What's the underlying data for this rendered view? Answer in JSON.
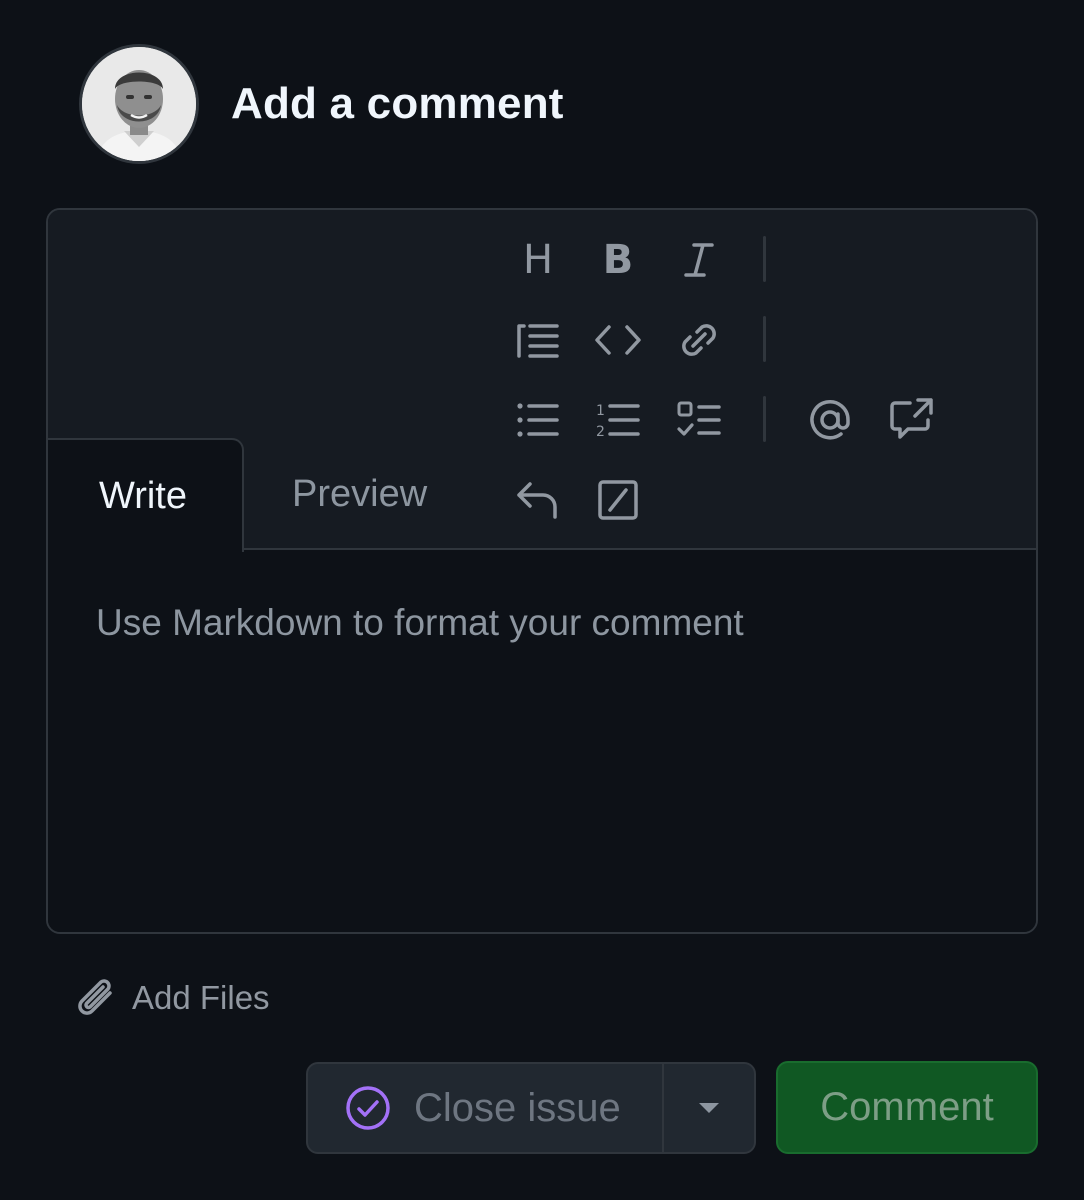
{
  "header": {
    "title": "Add a comment",
    "avatar_icon": "user-avatar"
  },
  "editor": {
    "tabs": [
      {
        "label": "Write",
        "selected": true
      },
      {
        "label": "Preview",
        "selected": false
      }
    ],
    "toolbar": {
      "heading_label": "H",
      "bold_label": "B",
      "icons": [
        "heading-icon",
        "bold-icon",
        "italic-icon",
        "quote-icon",
        "code-icon",
        "link-icon",
        "unordered-list-icon",
        "ordered-list-icon",
        "task-list-icon",
        "mention-icon",
        "reference-icon",
        "reply-icon",
        "slash-command-icon"
      ]
    },
    "body": {
      "value": "",
      "placeholder": "Use Markdown to format your comment"
    }
  },
  "attachments": {
    "label": "Add Files",
    "icon": "paperclip-icon"
  },
  "actions": {
    "close_label": "Close issue",
    "close_icon": "check-circle-icon",
    "close_icon_color": "#a371f7",
    "dropdown_icon": "caret-down-icon",
    "comment_label": "Comment",
    "comment_bg": "#105823"
  }
}
